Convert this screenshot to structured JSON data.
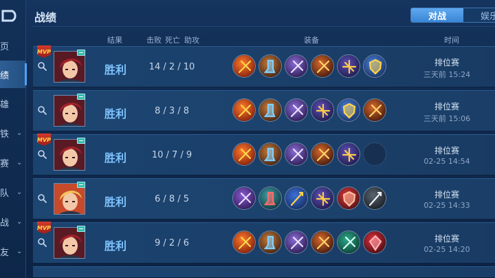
{
  "page_title": "战绩",
  "tabs": [
    {
      "label": "对战",
      "active": true
    },
    {
      "label": "娱乐",
      "active": false
    }
  ],
  "sidebar": {
    "items": [
      {
        "label": "页",
        "has_chevron": false,
        "active": false
      },
      {
        "label": "绩",
        "has_chevron": false,
        "active": true
      },
      {
        "label": "雄",
        "has_chevron": false,
        "active": false
      },
      {
        "label": "铁",
        "has_chevron": true,
        "active": false
      },
      {
        "label": "赛",
        "has_chevron": true,
        "active": false
      },
      {
        "label": "队",
        "has_chevron": true,
        "active": false
      },
      {
        "label": "战",
        "has_chevron": true,
        "active": false
      },
      {
        "label": "友",
        "has_chevron": true,
        "active": false
      }
    ]
  },
  "columns": {
    "result": "结果",
    "kills": "击败",
    "deaths": "死亡",
    "assists": "助攻",
    "equipment": "装备",
    "time": "时间"
  },
  "mvp_label": "MVP",
  "matches": [
    {
      "mvp": true,
      "hero": "red",
      "result": "胜利",
      "kda": "14 / 2 / 10",
      "mode": "排位赛",
      "time": "三天前 15:24",
      "items": [
        "fire-axe",
        "boots",
        "dark-axe",
        "fire-blade",
        "gold-crossbow",
        "blue-armor"
      ]
    },
    {
      "mvp": false,
      "hero": "red",
      "result": "胜利",
      "kda": "8 / 3 / 8",
      "mode": "排位赛",
      "time": "三天前 15:06",
      "items": [
        "fire-axe",
        "boots",
        "dark-axe",
        "gold-crossbow",
        "blue-armor",
        "fire-blade"
      ]
    },
    {
      "mvp": true,
      "hero": "red",
      "result": "胜利",
      "kda": "10 / 7 / 9",
      "mode": "排位赛",
      "time": "02-25 14:54",
      "items": [
        "fire-axe",
        "boots",
        "dark-axe",
        "fire-blade",
        "gold-crossbow",
        "empty"
      ]
    },
    {
      "mvp": false,
      "hero": "blond",
      "result": "胜利",
      "kda": "6 / 8 / 5",
      "mode": "排位赛",
      "time": "02-25 14:33",
      "items": [
        "purple-axe",
        "teal-boots",
        "blue-staff",
        "gold-crossbow",
        "red-shield",
        "spear"
      ]
    },
    {
      "mvp": true,
      "hero": "red",
      "result": "胜利",
      "kda": "9 / 2 / 6",
      "mode": "排位赛",
      "time": "02-25 14:20",
      "items": [
        "fire-axe",
        "boots",
        "dark-axe",
        "fire-blade",
        "green-sword",
        "red-gem"
      ]
    }
  ],
  "colors": {
    "accent": "#4da3ff",
    "win": "#7fc3ff",
    "background": "#10294d"
  }
}
